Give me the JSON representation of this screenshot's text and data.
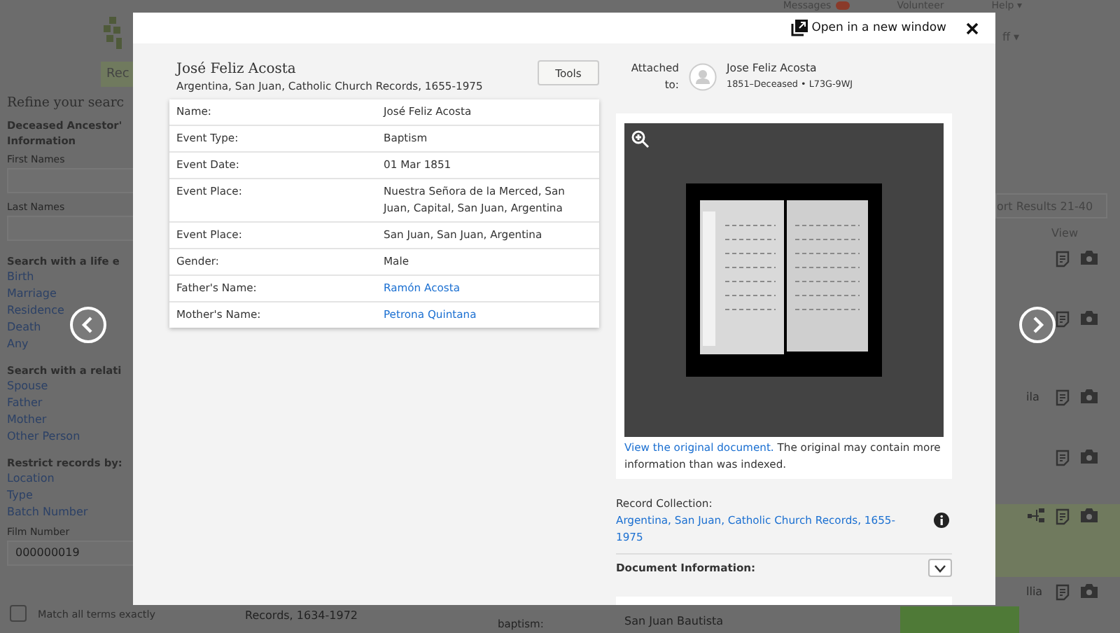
{
  "background_page": {
    "top_links": [
      "Messages",
      "Volunteer",
      "Help ▾"
    ],
    "account_menu": "ff ▾",
    "nav_tab": "Rec",
    "sidebar": {
      "heading": "Refine your searc",
      "ancestor_title_lines": [
        "Deceased Ancestor'",
        "Information"
      ],
      "fields": [
        {
          "label": "First Names"
        },
        {
          "label": "Last Names"
        }
      ],
      "groups": [
        {
          "title": "Search with a life e",
          "links": [
            "Birth",
            "Marriage",
            "Residence",
            "Death",
            "Any"
          ]
        },
        {
          "title": "Search with a relati",
          "links": [
            "Spouse",
            "Father",
            "Mother",
            "Other Person"
          ]
        },
        {
          "title": "Restrict records by:",
          "links": [
            "Location",
            "Type",
            "Batch Number"
          ]
        }
      ],
      "film_field": {
        "label": "Film Number",
        "value": "000000019"
      },
      "match_checkbox": {
        "label": "Match all terms exactly",
        "checked": false
      }
    },
    "results": {
      "sort_button": "ort Results 21-40",
      "view_header": "View",
      "rows": [
        {
          "fragment": "",
          "selected": false,
          "tree": false
        },
        {
          "fragment": "",
          "selected": false,
          "tree": false
        },
        {
          "fragment": "ila",
          "selected": false,
          "tree": false
        },
        {
          "fragment": "",
          "selected": false,
          "tree": false
        },
        {
          "fragment": "",
          "selected": true,
          "tree": true
        },
        {
          "fragment": "llia",
          "selected": false,
          "tree": false
        }
      ],
      "bottom_texts": [
        "Records, 1634-1972",
        "baptism:",
        "San Juan Bautista"
      ]
    }
  },
  "modal": {
    "open_new_window": "Open in a new window",
    "record": {
      "name": "José Feliz Acosta",
      "collection": "Argentina, San Juan, Catholic Church Records, 1655-1975",
      "tools_button": "Tools",
      "fields": [
        {
          "label": "Name:",
          "value": "José Feliz Acosta",
          "link": false
        },
        {
          "label": "Event Type:",
          "value": "Baptism",
          "link": false
        },
        {
          "label": "Event Date:",
          "value": "01 Mar 1851",
          "link": false
        },
        {
          "label": "Event Place:",
          "value": "Nuestra Señora de la Merced, San Juan, Capital, San Juan, Argentina",
          "link": false
        },
        {
          "label": "Event Place:",
          "value": "San Juan, San Juan, Argentina",
          "link": false
        },
        {
          "label": "Gender:",
          "value": "Male",
          "link": false
        },
        {
          "label": "Father's Name:",
          "value": "Ramón Acosta",
          "link": true
        },
        {
          "label": "Mother's Name:",
          "value": "Petrona Quintana",
          "link": true
        }
      ]
    },
    "attached": {
      "label": "Attached to:",
      "name": "Jose Feliz Acosta",
      "details": "1851–Deceased • L73G-9WJ"
    },
    "image_caption": {
      "link": "View the original document.",
      "text": "The original may contain more information than was indexed."
    },
    "record_collection": {
      "label": "Record Collection:",
      "link": "Argentina, San Juan, Catholic Church Records, 1655-1975"
    },
    "document_information": {
      "label": "Document Information:",
      "expanded": false
    }
  }
}
